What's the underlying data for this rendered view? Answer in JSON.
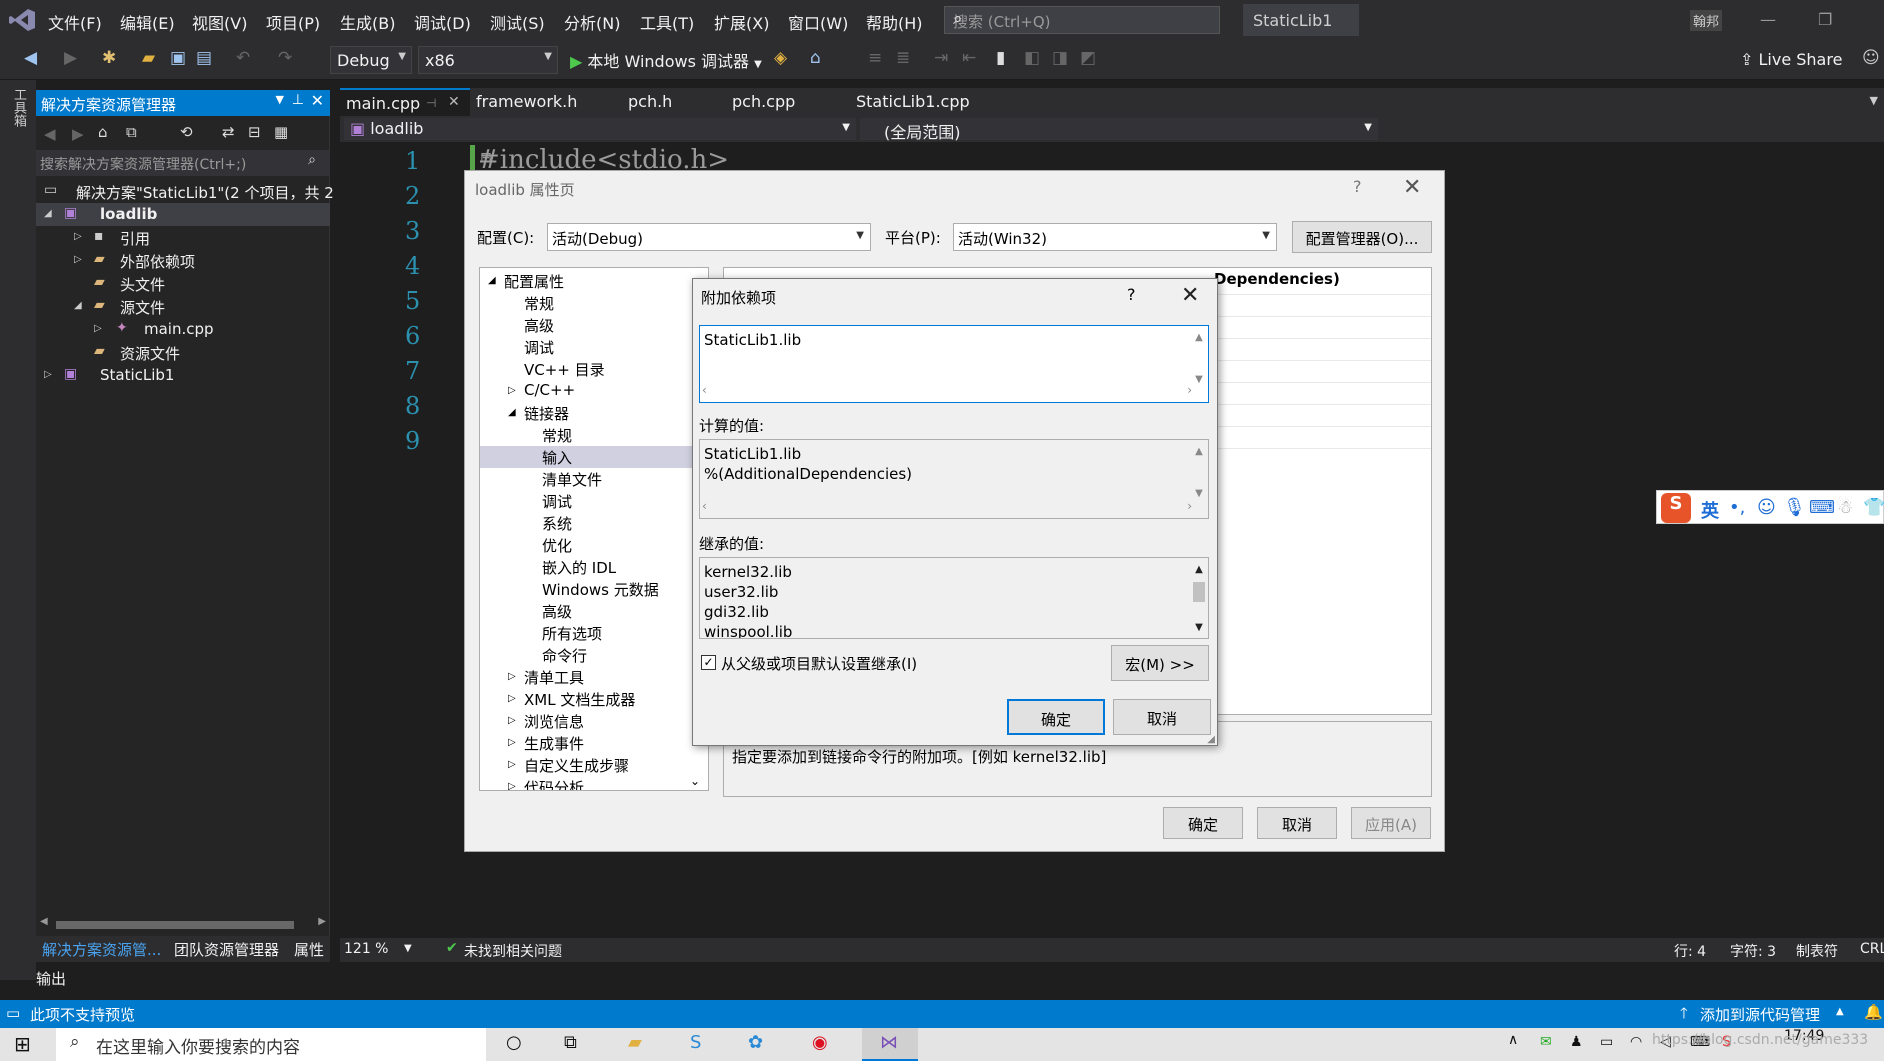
{
  "app": {
    "menu": [
      "文件(F)",
      "编辑(E)",
      "视图(V)",
      "项目(P)",
      "生成(B)",
      "调试(D)",
      "测试(S)",
      "分析(N)",
      "工具(T)",
      "扩展(X)",
      "窗口(W)",
      "帮助(H)"
    ],
    "search_placeholder": "搜索 (Ctrl+Q)",
    "solution_title": "StaticLib1",
    "user_initials": "翰邦",
    "live_share": "Live Share"
  },
  "toolbar": {
    "config": "Debug",
    "platform": "x86",
    "run_label": "本地 Windows 调试器"
  },
  "left_strip_label": "工具箱",
  "solution_explorer": {
    "header": "解决方案资源管理器",
    "search_placeholder": "搜索解决方案资源管理器(Ctrl+;)",
    "items": [
      {
        "label": "解决方案\"StaticLib1\"(2 个项目，共 2"
      },
      {
        "label": "loadlib"
      },
      {
        "label": "引用"
      },
      {
        "label": "外部依赖项"
      },
      {
        "label": "头文件"
      },
      {
        "label": "源文件"
      },
      {
        "label": "main.cpp"
      },
      {
        "label": "资源文件"
      },
      {
        "label": "StaticLib1"
      }
    ],
    "bottom_tabs": [
      "解决方案资源管...",
      "团队资源管理器",
      "属性"
    ]
  },
  "editor": {
    "tabs": [
      "main.cpp",
      "framework.h",
      "pch.h",
      "pch.cpp",
      "StaticLib1.cpp"
    ],
    "nav_left": "loadlib",
    "nav_right": "(全局范围)",
    "line_numbers": [
      "1",
      "2",
      "3",
      "4",
      "5",
      "6",
      "7",
      "8",
      "9"
    ],
    "code_line1": "#include<stdio.h>",
    "zoom": "121 %",
    "issues": "未找到相关问题",
    "row": "行: 4",
    "col": "字符: 3",
    "tab_mode": "制表符",
    "eol": "CRL"
  },
  "output_label": "输出",
  "statusbar": {
    "left": "此项不支持预览",
    "right": "添加到源代码管理"
  },
  "taskbar": {
    "search_placeholder": "在这里输入你要搜索的内容",
    "time": "17:49",
    "watermark": "https://blog.csdn.net/game333"
  },
  "ime": {
    "lang": "英"
  },
  "property_dialog": {
    "title": "loadlib 属性页",
    "config_label": "配置(C):",
    "config_value": "活动(Debug)",
    "platform_label": "平台(P):",
    "platform_value": "活动(Win32)",
    "config_manager": "配置管理器(O)...",
    "tree": [
      {
        "label": "配置属性"
      },
      {
        "label": "常规"
      },
      {
        "label": "高级"
      },
      {
        "label": "调试"
      },
      {
        "label": "VC++ 目录"
      },
      {
        "label": "C/C++"
      },
      {
        "label": "链接器"
      },
      {
        "label": "常规"
      },
      {
        "label": "输入"
      },
      {
        "label": "清单文件"
      },
      {
        "label": "调试"
      },
      {
        "label": "系统"
      },
      {
        "label": "优化"
      },
      {
        "label": "嵌入的 IDL"
      },
      {
        "label": "Windows 元数据"
      },
      {
        "label": "高级"
      },
      {
        "label": "所有选项"
      },
      {
        "label": "命令行"
      },
      {
        "label": "清单工具"
      },
      {
        "label": "XML 文档生成器"
      },
      {
        "label": "浏览信息"
      },
      {
        "label": "生成事件"
      },
      {
        "label": "自定义生成步骤"
      },
      {
        "label": "代码分析"
      }
    ],
    "grid_header_right": "Dependencies)",
    "description": "指定要添加到链接命令行的附加项。[例如 kernel32.lib]",
    "ok": "确定",
    "cancel": "取消",
    "apply": "应用(A)"
  },
  "deps_dialog": {
    "title": "附加依赖项",
    "help": "?",
    "input_value": "StaticLib1.lib",
    "computed_label": "计算的值:",
    "computed": [
      "StaticLib1.lib",
      "%(AdditionalDependencies)"
    ],
    "inherited_label": "继承的值:",
    "inherited": [
      "kernel32.lib",
      "user32.lib",
      "gdi32.lib",
      "winspool.lib"
    ],
    "inherit_checkbox": "从父级或项目默认设置继承(I)",
    "inherit_checked": true,
    "macro_button": "宏(M) >>",
    "ok": "确定",
    "cancel": "取消"
  }
}
